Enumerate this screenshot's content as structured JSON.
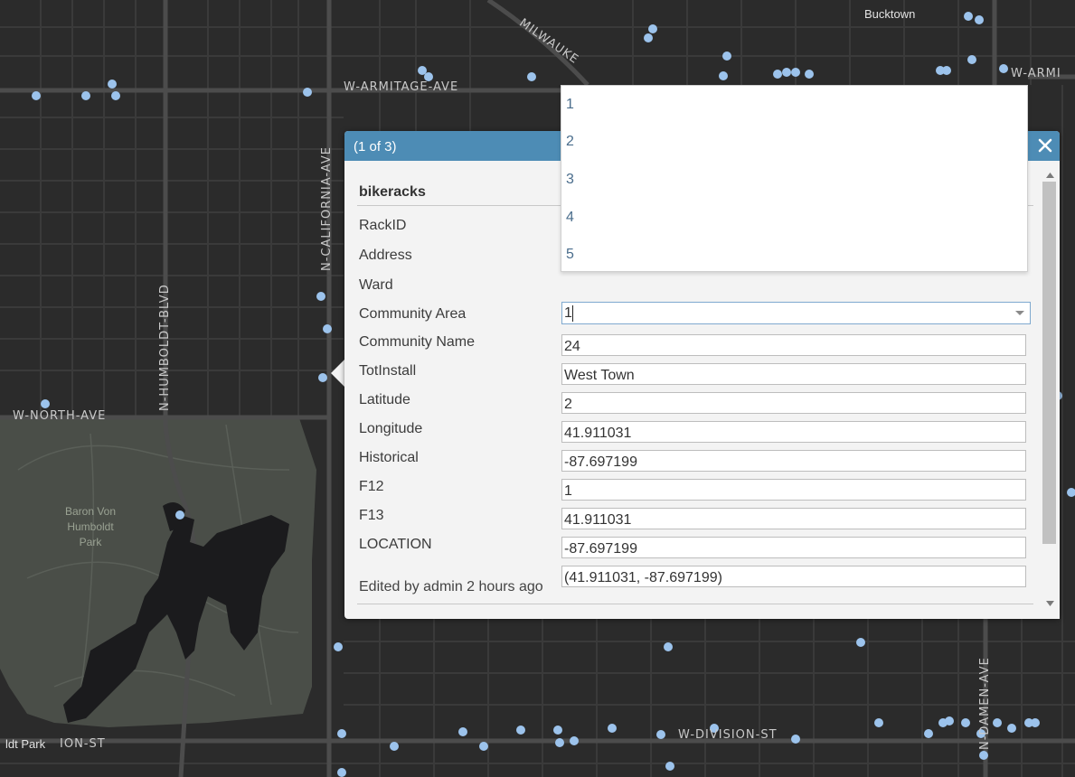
{
  "map": {
    "streets": {
      "armitage_ave": "W-ARMITAGE-AVE",
      "armitage_ave_east": "W-ARMI",
      "milwaukee": "MILWAUKE",
      "north_ave": "W-NORTH-AVE",
      "division_st": "W-DIVISION-ST",
      "division_st_west": "ION-ST",
      "california_ave": "N-CALIFORNIA-AVE",
      "humboldt_blvd": "N-HUMBOLDT-BLVD",
      "damen_ave": "N-DAMEN-AVE"
    },
    "places": {
      "bucktown": "Bucktown",
      "park_line1": "Baron Von",
      "park_line2": "Humboldt",
      "park_line3": "Park",
      "bottom_left": "ldt Park"
    },
    "colors": {
      "background": "#2b2b2b",
      "park": "#4a4e48",
      "road": "#4c4c4c",
      "lake": "#1b1b1d",
      "marker": "#9cc3ec"
    }
  },
  "popup": {
    "count_text": "(1 of 3)",
    "close_icon": "close-icon",
    "layer_name": "bikeracks",
    "header_color": "#4d8cb5",
    "fields": [
      {
        "label": "RackID",
        "value": ""
      },
      {
        "label": "Address",
        "value": ""
      },
      {
        "label": "Ward",
        "value": "1"
      },
      {
        "label": "Community Area",
        "value": "24"
      },
      {
        "label": "Community Name",
        "value": "West Town"
      },
      {
        "label": "TotInstall",
        "value": "2"
      },
      {
        "label": "Latitude",
        "value": "41.911031"
      },
      {
        "label": "Longitude",
        "value": "-87.697199"
      },
      {
        "label": "Historical",
        "value": "1"
      },
      {
        "label": "F12",
        "value": "41.911031"
      },
      {
        "label": "F13",
        "value": "-87.697199"
      },
      {
        "label": "LOCATION",
        "value": "(41.911031, -87.697199)"
      }
    ],
    "edited_by": "Edited by admin 2 hours ago"
  },
  "ward_dropdown": {
    "options": [
      "1",
      "2",
      "3",
      "4",
      "5"
    ]
  }
}
